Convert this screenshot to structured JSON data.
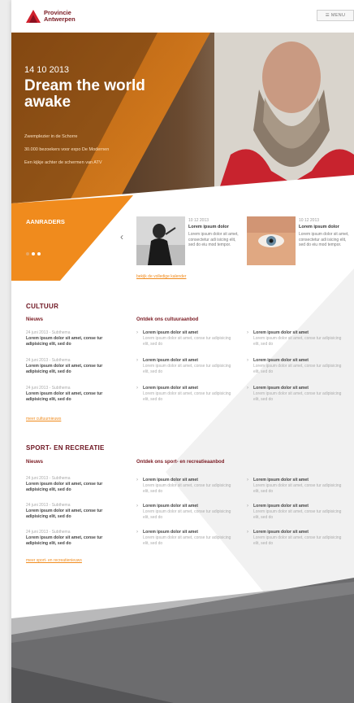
{
  "header": {
    "brand_line1": "Provincie",
    "brand_line2": "Antwerpen",
    "menu_label": "☰ MENU"
  },
  "hero": {
    "date": "14 10 2013",
    "title": "Dream the world awake",
    "links": [
      "Zwemplezier in de Schorre",
      "30.000 bezoekers voor expo De Modernen",
      "Een kijkje achter de schermen van ATV"
    ]
  },
  "aanraders": {
    "title": "AANRADERS",
    "cards": [
      {
        "date": "10 12 2013",
        "title": "Lorem ipsum dolor",
        "desc": "Lorem ipsum dolor sit amet, consectetur adi isicing elit, sed do eiu mod tempor."
      },
      {
        "date": "10 12 2013",
        "title": "Lorem ipsum dolor",
        "desc": "Lorem ipsum dolor sit amet, consectetur adi isicing elit, sed do eiu mod tempor."
      }
    ],
    "calendar_link": "bekijk de volledige kalender"
  },
  "cultuur": {
    "title": "CULTUUR",
    "news_label": "Nieuws",
    "offer_title": "Ontdek ons cultuuraanbod",
    "news": [
      {
        "date": "24 juni 2013 - Subthema",
        "title": "Lorem ipsum dolor sit amet, conse tur adipisicing elit, sed do"
      },
      {
        "date": "24 juni 2013 - Subthema",
        "title": "Lorem ipsum dolor sit amet, conse tur adipisicing elit, sed do"
      },
      {
        "date": "24 juni 2013 - Subthema",
        "title": "Lorem ipsum dolor sit amet, conse tur adipisicing elit, sed do"
      }
    ],
    "more_link": "meer cultuurnieuws",
    "offers": [
      {
        "title": "Lorem ipsum dolor sit amet",
        "desc": "Lorem ipsum dolor sit amet, conse tur adipisicing elit, sed do"
      },
      {
        "title": "Lorem ipsum dolor sit amet",
        "desc": "Lorem ipsum dolor sit amet, conse tur adipisicing elit, sed do"
      },
      {
        "title": "Lorem ipsum dolor sit amet",
        "desc": "Lorem ipsum dolor sit amet, conse tur adipisicing elit, sed do"
      },
      {
        "title": "Lorem ipsum dolor sit amet",
        "desc": "Lorem ipsum dolor sit amet, conse tur adipisicing elit, sed do"
      },
      {
        "title": "Lorem ipsum dolor sit amet",
        "desc": "Lorem ipsum dolor sit amet, conse tur adipisicing elit, sed do"
      },
      {
        "title": "Lorem ipsum dolor sit amet",
        "desc": "Lorem ipsum dolor sit amet, conse tur adipisicing elit, sed do"
      }
    ]
  },
  "sport": {
    "title": "SPORT- EN RECREATIE",
    "news_label": "Nieuws",
    "offer_title": "Ontdek ons sport- en recreatieaanbod",
    "news": [
      {
        "date": "24 juni 2013 - Subthema",
        "title": "Lorem ipsum dolor sit amet, conse tur adipisicing elit, sed do"
      },
      {
        "date": "24 juni 2013 - Subthema",
        "title": "Lorem ipsum dolor sit amet, conse tur adipisicing elit, sed do"
      },
      {
        "date": "24 juni 2013 - Subthema",
        "title": "Lorem ipsum dolor sit amet, conse tur adipisicing elit, sed do"
      }
    ],
    "more_link": "meer sport- en recreatienieuws",
    "offers": [
      {
        "title": "Lorem ipsum dolor sit amet",
        "desc": "Lorem ipsum dolor sit amet, conse tur adipisicing elit, sed do"
      },
      {
        "title": "Lorem ipsum dolor sit amet",
        "desc": "Lorem ipsum dolor sit amet, conse tur adipisicing elit, sed do"
      },
      {
        "title": "Lorem ipsum dolor sit amet",
        "desc": "Lorem ipsum dolor sit amet, conse tur adipisicing elit, sed do"
      },
      {
        "title": "Lorem ipsum dolor sit amet",
        "desc": "Lorem ipsum dolor sit amet, conse tur adipisicing elit, sed do"
      },
      {
        "title": "Lorem ipsum dolor sit amet",
        "desc": "Lorem ipsum dolor sit amet, conse tur adipisicing elit, sed do"
      },
      {
        "title": "Lorem ipsum dolor sit amet",
        "desc": "Lorem ipsum dolor sit amet, conse tur adipisicing elit, sed do"
      }
    ]
  },
  "colors": {
    "accent_orange": "#f08b1d",
    "brand_red": "#d0212d",
    "heading_maroon": "#6d1420",
    "footer_gray": "#6c6c6e"
  }
}
